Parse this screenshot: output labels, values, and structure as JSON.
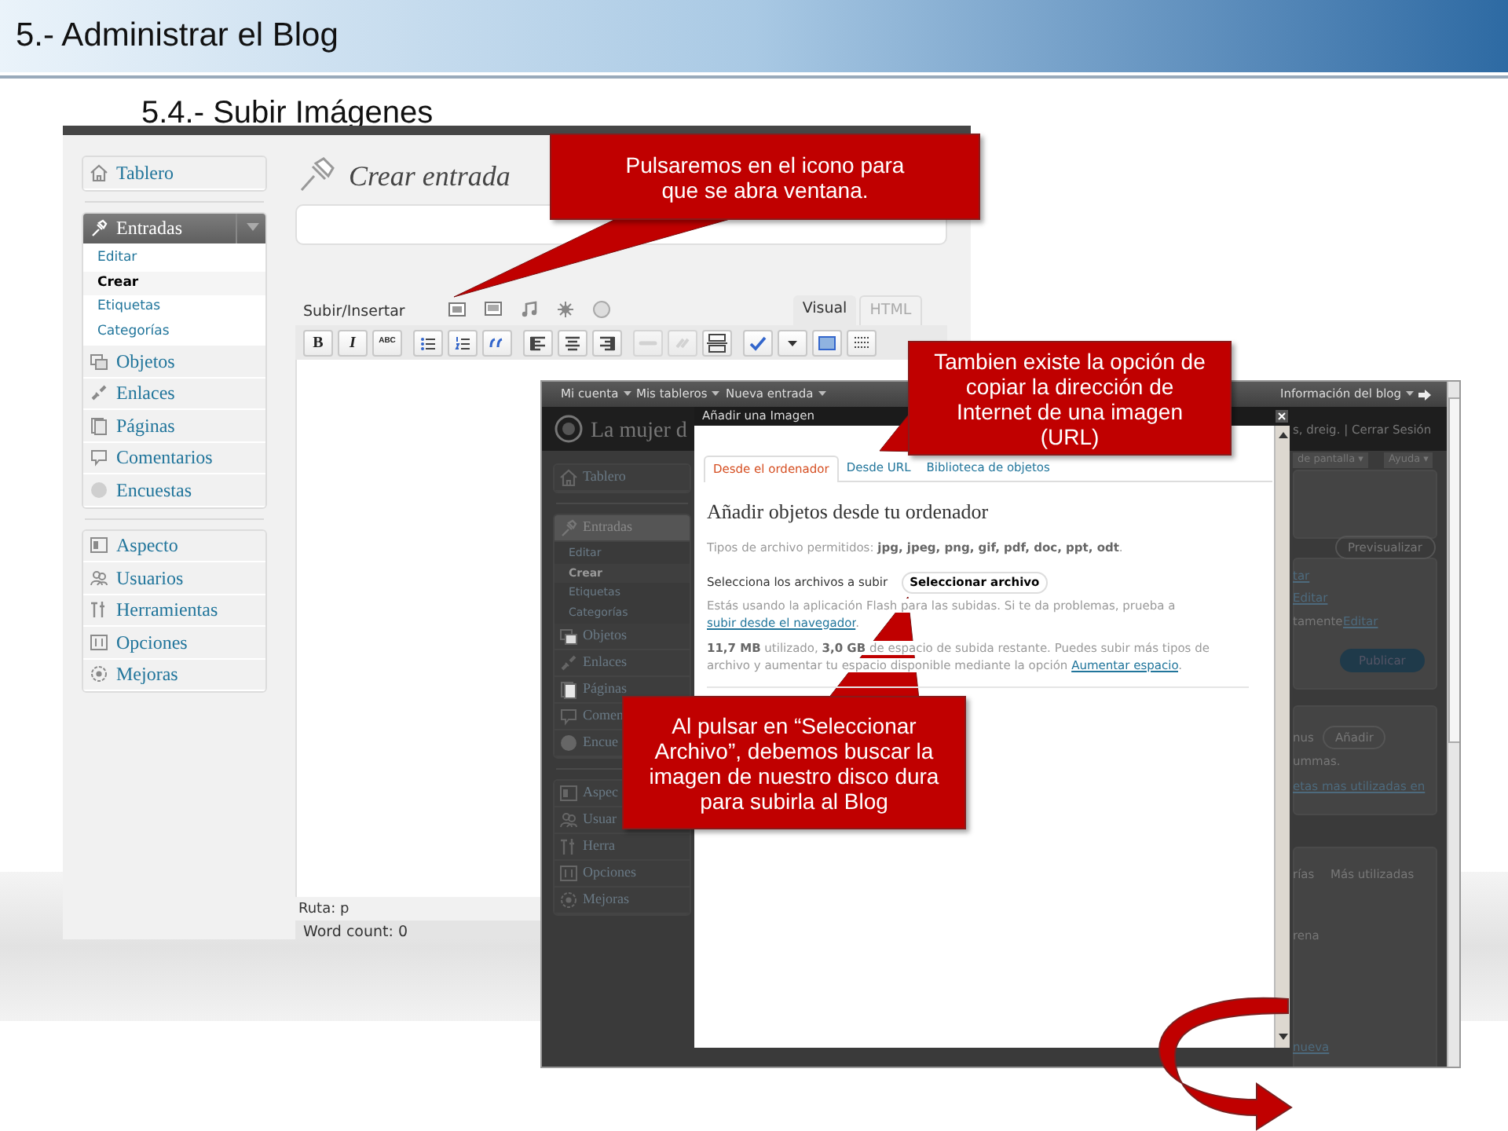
{
  "slide": {
    "title": "5.- Administrar el Blog",
    "subtitle": "5.4.- Subir Imágenes"
  },
  "editor_screen": {
    "menu_groups": [
      {
        "items": [
          {
            "label": "Tablero",
            "kind": "dashboard",
            "selected": false
          }
        ]
      },
      {
        "items": [
          {
            "label": "Entradas",
            "kind": "pin",
            "selected": true,
            "children": [
              {
                "label": "Editar",
                "selected": false
              },
              {
                "label": "Crear",
                "selected": true
              },
              {
                "label": "Etiquetas",
                "selected": false
              },
              {
                "label": "Categorías",
                "selected": false
              }
            ]
          },
          {
            "label": "Objetos",
            "kind": "media",
            "selected": false
          },
          {
            "label": "Enlaces",
            "kind": "links",
            "selected": false
          },
          {
            "label": "Páginas",
            "kind": "pages",
            "selected": false
          },
          {
            "label": "Comentarios",
            "kind": "comments",
            "selected": false
          },
          {
            "label": "Encuestas",
            "kind": "polls",
            "selected": false
          }
        ]
      },
      {
        "items": [
          {
            "label": "Aspecto",
            "kind": "appearance",
            "selected": false
          },
          {
            "label": "Usuarios",
            "kind": "users",
            "selected": false
          },
          {
            "label": "Herramientas",
            "kind": "tools",
            "selected": false
          },
          {
            "label": "Opciones",
            "kind": "settings",
            "selected": false
          },
          {
            "label": "Mejoras",
            "kind": "plugins",
            "selected": false
          }
        ]
      }
    ],
    "page_title": "Crear entrada",
    "media_label": "Subir/Insertar",
    "media_buttons": [
      {
        "kind": "image"
      },
      {
        "kind": "video"
      },
      {
        "kind": "audio"
      },
      {
        "kind": "media"
      },
      {
        "kind": "poll"
      }
    ],
    "editor_tabs": [
      {
        "label": "Visual",
        "selected": true
      },
      {
        "label": "HTML",
        "selected": false
      }
    ],
    "toolbar": [
      [
        {
          "kind": "bold",
          "label": "B",
          "disabled": false
        },
        {
          "kind": "italic",
          "label": "I",
          "disabled": false
        },
        {
          "kind": "strike",
          "label": "ABC",
          "disabled": false
        }
      ],
      [
        {
          "kind": "bullet-list",
          "disabled": false
        },
        {
          "kind": "number-list",
          "disabled": false
        },
        {
          "kind": "quote",
          "disabled": false
        }
      ],
      [
        {
          "kind": "align-left",
          "disabled": false
        },
        {
          "kind": "align-center",
          "disabled": false
        },
        {
          "kind": "align-right",
          "disabled": false
        }
      ],
      [
        {
          "kind": "link",
          "disabled": true
        },
        {
          "kind": "unlink",
          "disabled": true
        },
        {
          "kind": "more",
          "disabled": false
        }
      ],
      [
        {
          "kind": "spellcheck",
          "disabled": false
        },
        {
          "kind": "dropdown",
          "disabled": false
        },
        {
          "kind": "fullscreen",
          "disabled": false
        },
        {
          "kind": "kitchen-sink",
          "disabled": false
        }
      ]
    ],
    "path": "Ruta: p",
    "word_count": "Word count: 0"
  },
  "upload_screen": {
    "admin_bar": [
      {
        "label": "Mi cuenta",
        "dropdown": true
      },
      {
        "label": "Mis tableros",
        "dropdown": true
      },
      {
        "label": "Nueva entrada",
        "dropdown": true
      },
      {
        "label": "Información del blog",
        "dropdown": true
      }
    ],
    "blog_name": "La mujer d",
    "menu_groups": [
      {
        "items": [
          {
            "label": "Tablero",
            "kind": "dashboard",
            "selected": false
          }
        ]
      },
      {
        "items": [
          {
            "label": "Entradas",
            "kind": "pin",
            "selected": true,
            "children": [
              {
                "label": "Editar",
                "selected": false
              },
              {
                "label": "Crear",
                "selected": true
              },
              {
                "label": "Etiquetas",
                "selected": false
              },
              {
                "label": "Categorías",
                "selected": false
              }
            ]
          },
          {
            "label": "Objetos",
            "kind": "media",
            "selected": false
          },
          {
            "label": "Enlaces",
            "kind": "links",
            "selected": false
          },
          {
            "label": "Páginas",
            "kind": "pages",
            "selected": false
          },
          {
            "label": "Comen",
            "kind": "comments",
            "selected": false
          },
          {
            "label": "Encue",
            "kind": "polls",
            "selected": false
          }
        ]
      },
      {
        "items": [
          {
            "label": "Aspec",
            "kind": "appearance",
            "selected": false
          },
          {
            "label": "Usuar",
            "kind": "users",
            "selected": false
          },
          {
            "label": "Herra",
            "kind": "tools",
            "selected": false
          },
          {
            "label": "Opciones",
            "kind": "settings",
            "selected": false
          },
          {
            "label": "Mejoras",
            "kind": "plugins",
            "selected": false
          }
        ]
      }
    ],
    "right_column": [
      {
        "kind": "text",
        "text": "s, dreig. | Cerrar Sesión"
      },
      {
        "kind": "tab",
        "text": "de pantalla ▾"
      },
      {
        "kind": "tab",
        "text": "Ayuda ▾"
      },
      {
        "kind": "button",
        "text": "Previsualizar"
      },
      {
        "kind": "link",
        "text": "tar"
      },
      {
        "kind": "link",
        "text": "Editar"
      },
      {
        "kind": "text",
        "text": "tamente"
      },
      {
        "kind": "link",
        "text": "Editar"
      },
      {
        "kind": "primary",
        "text": "Publicar"
      },
      {
        "kind": "text",
        "text": "nus"
      },
      {
        "kind": "button",
        "text": "Añadir"
      },
      {
        "kind": "text",
        "text": "ummas."
      },
      {
        "kind": "link",
        "text": "etas mas utilizadas en"
      },
      {
        "kind": "text",
        "text": "rías"
      },
      {
        "kind": "text",
        "text": "Más utilizadas"
      },
      {
        "kind": "text",
        "text": "rena"
      },
      {
        "kind": "link",
        "text": "nueva"
      }
    ],
    "dialog": {
      "title": "Añadir una Imagen",
      "tabs": [
        {
          "label": "Desde el ordenador",
          "selected": true
        },
        {
          "label": "Desde URL",
          "selected": false
        },
        {
          "label": "Biblioteca de objetos",
          "selected": false
        }
      ],
      "heading": "Añadir objetos desde tu ordenador",
      "allowed_types": "Tipos de archivo permitidos: **jpg, jpeg, png, gif, pdf, doc, ppt, odt**.",
      "select_label": "Selecciona los archivos a subir",
      "select_button": "Seleccionar archivo",
      "flash_note": "Estás usando la aplicación Flash para las subidas. Si te da problemas, prueba a",
      "flash_link": "subir desde el navegador",
      "flash_end": ".",
      "quota_note": "**11,7 MB** utilizado, **3,0 GB** de espacio de subida restante. Puedes subir más tipos de archivo y aumentar tu espacio disponible mediante la opción",
      "quota_link": "Aumentar espacio",
      "quota_end": "."
    }
  },
  "callouts": [
    {
      "text": "Pulsaremos en el icono para que se abra ventana."
    },
    {
      "text": "Tambien existe la opción de copiar la dirección de Internet de una imagen (URL)"
    },
    {
      "text": "Al pulsar en “Seleccionar Archivo”, debemos buscar la imagen de nuestro disco dura para subirla al Blog"
    }
  ]
}
